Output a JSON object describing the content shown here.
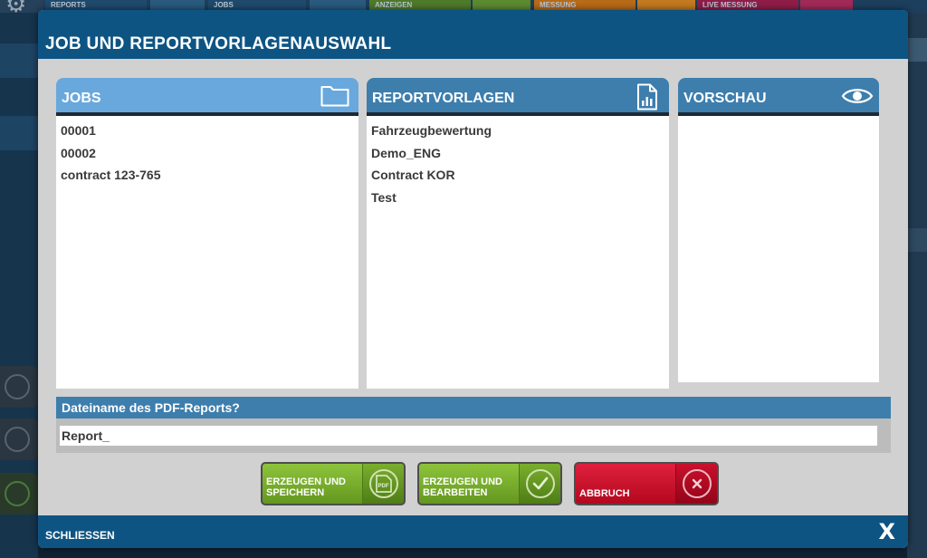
{
  "background": {
    "tabs": [
      "REPORTS",
      "JOBS",
      "ANZEIGEN EINSTELLUNGEN",
      "MESSUNG",
      "LIVE MESSUNG"
    ]
  },
  "dialog": {
    "title": "JOB UND REPORTVORLAGENAUSWAHL",
    "close_label": "SCHLIESSEN",
    "close_x": "X"
  },
  "panels": {
    "jobs": {
      "title": "JOBS",
      "icon": "folder-icon",
      "items": [
        "00001",
        "00002",
        "contract 123-765"
      ]
    },
    "templates": {
      "title": "REPORTVORLAGEN",
      "icon": "document-chart-icon",
      "items": [
        "Fahrzeugbewertung",
        "Demo_ENG",
        "Contract KOR",
        "Test"
      ]
    },
    "preview": {
      "title": "VORSCHAU",
      "icon": "eye-icon"
    }
  },
  "filename": {
    "label": "Dateiname des PDF-Reports?",
    "value": "Report_"
  },
  "buttons": {
    "create_save": {
      "line1": "ERZEUGEN UND",
      "line2": "SPEICHERN",
      "icon": "pdf-icon",
      "color": "#7fb530"
    },
    "create_edit": {
      "line1": "ERZEUGEN UND",
      "line2": "BEARBEITEN",
      "icon": "check-icon",
      "color": "#7fb530"
    },
    "cancel": {
      "label": "ABBRUCH",
      "icon": "cancel-icon",
      "color": "#d0142f"
    }
  }
}
